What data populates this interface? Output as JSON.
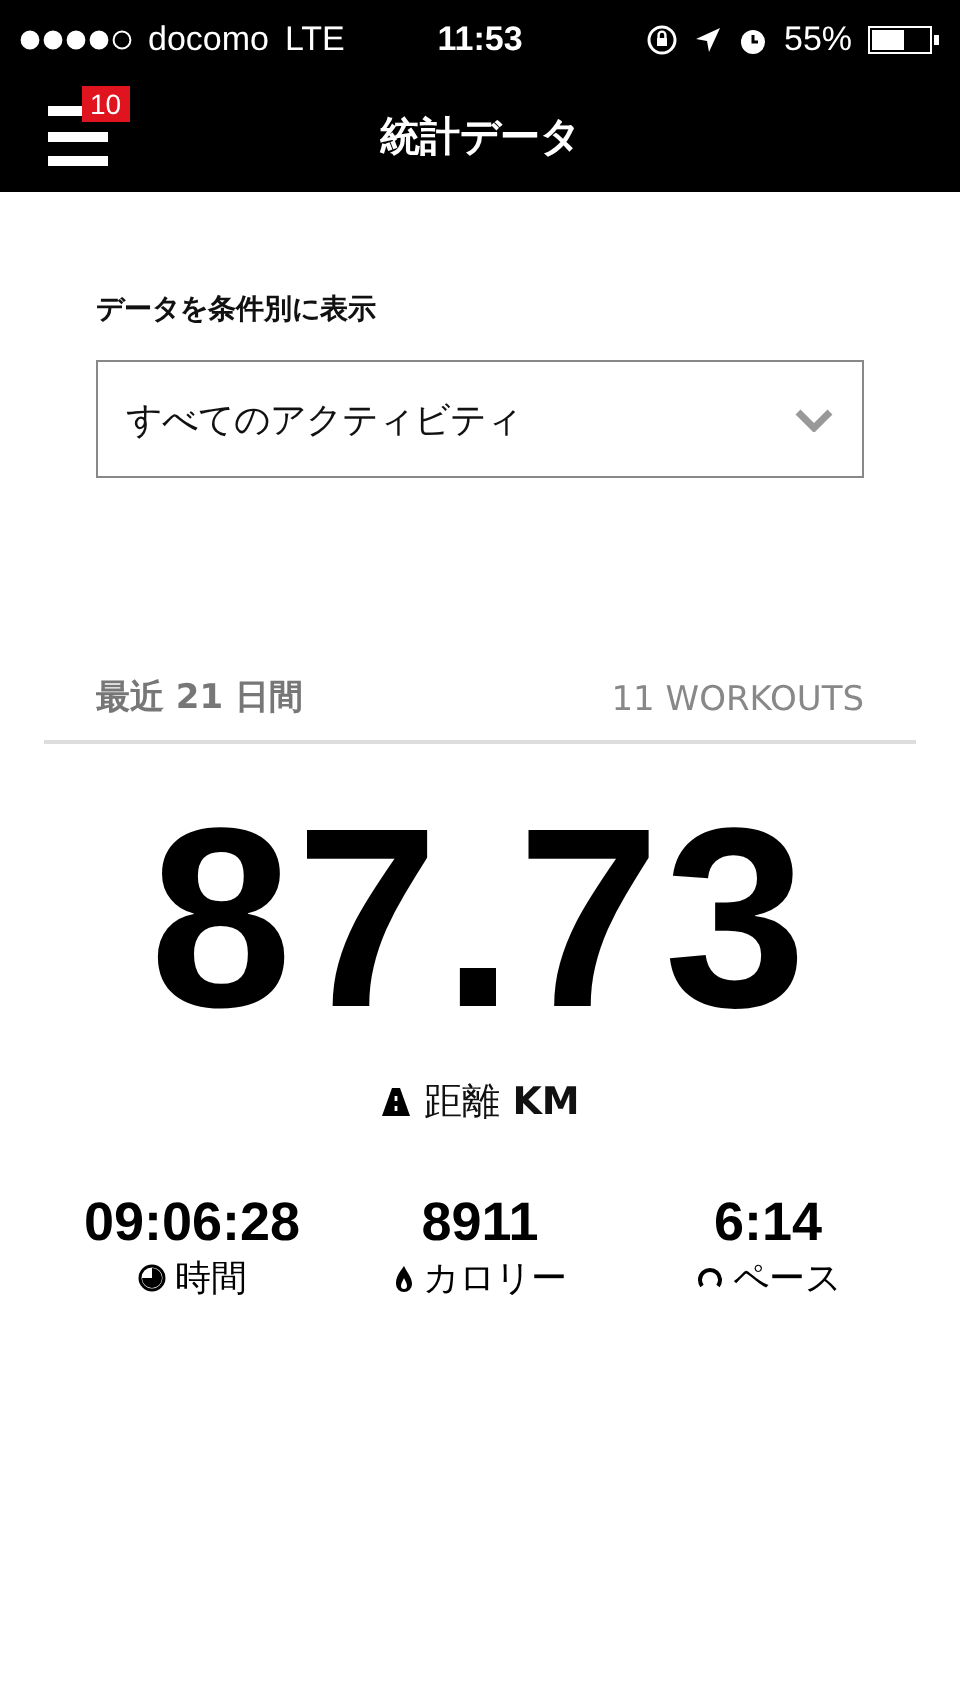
{
  "status_bar": {
    "carrier": "docomo",
    "network": "LTE",
    "time": "11:53",
    "battery": "55%"
  },
  "nav": {
    "title": "統計データ",
    "badge": "10"
  },
  "filter": {
    "label": "データを条件別に表示",
    "value": "すべてのアクティビティ"
  },
  "summary": {
    "period": "最近 21 日間",
    "workouts": "11 WORKOUTS",
    "distance": "87.73",
    "distance_label": "距離",
    "distance_unit": "KM"
  },
  "stats": [
    {
      "kind": "time",
      "value": "09:06:28",
      "label": "時間"
    },
    {
      "kind": "calories",
      "value": "8911",
      "label": "カロリー"
    },
    {
      "kind": "pace",
      "value": "6:14",
      "label": "ペース"
    }
  ]
}
